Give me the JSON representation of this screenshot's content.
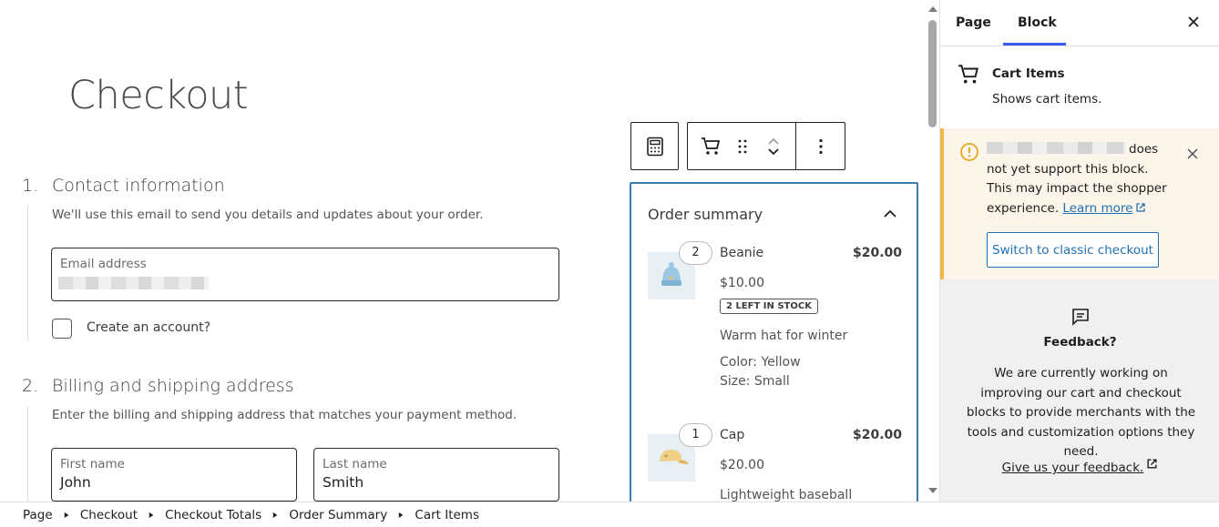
{
  "canvas": {
    "page_title": "Checkout",
    "contact": {
      "number": "1.",
      "title": "Contact information",
      "description": "We'll use this email to send you details and updates about your order.",
      "email_label": "Email address",
      "create_account_label": "Create an account?"
    },
    "billing": {
      "number": "2.",
      "title": "Billing and shipping address",
      "description": "Enter the billing and shipping address that matches your payment method.",
      "first_name_label": "First name",
      "first_name_value": "John",
      "last_name_label": "Last name",
      "last_name_value": "Smith"
    },
    "order_summary": {
      "title": "Order summary",
      "items": [
        {
          "quantity": "2",
          "name": "Beanie",
          "total": "$20.00",
          "unit_price": "$10.00",
          "badge": "2 LEFT IN STOCK",
          "description": "Warm hat for winter",
          "meta": [
            "Color: Yellow",
            "Size: Small"
          ],
          "image_icon": "beanie-image"
        },
        {
          "quantity": "1",
          "name": "Cap",
          "total": "$20.00",
          "unit_price": "$20.00",
          "description": "Lightweight baseball",
          "image_icon": "cap-image"
        }
      ]
    }
  },
  "sidebar": {
    "tabs": [
      "Page",
      "Block"
    ],
    "active_tab": "Block",
    "block": {
      "name": "Cart Items",
      "description": "Shows cart items."
    },
    "notice": {
      "text_after_blur": "does not yet support this block. This may impact the shopper experience.",
      "link": "Learn more",
      "button": "Switch to classic checkout"
    },
    "feedback": {
      "title": "Feedback?",
      "body": "We are currently working on improving our cart and checkout blocks to provide merchants with the tools and customization options they need.",
      "link": "Give us your feedback."
    }
  },
  "breadcrumb": [
    "Page",
    "Checkout",
    "Checkout Totals",
    "Order Summary",
    "Cart Items"
  ],
  "colors": {
    "accent": "#3858e9",
    "link": "#2271b1",
    "selected_block_border": "#3a7cad",
    "notice_border": "#f0b849",
    "notice_bg": "#fcf5ea"
  }
}
